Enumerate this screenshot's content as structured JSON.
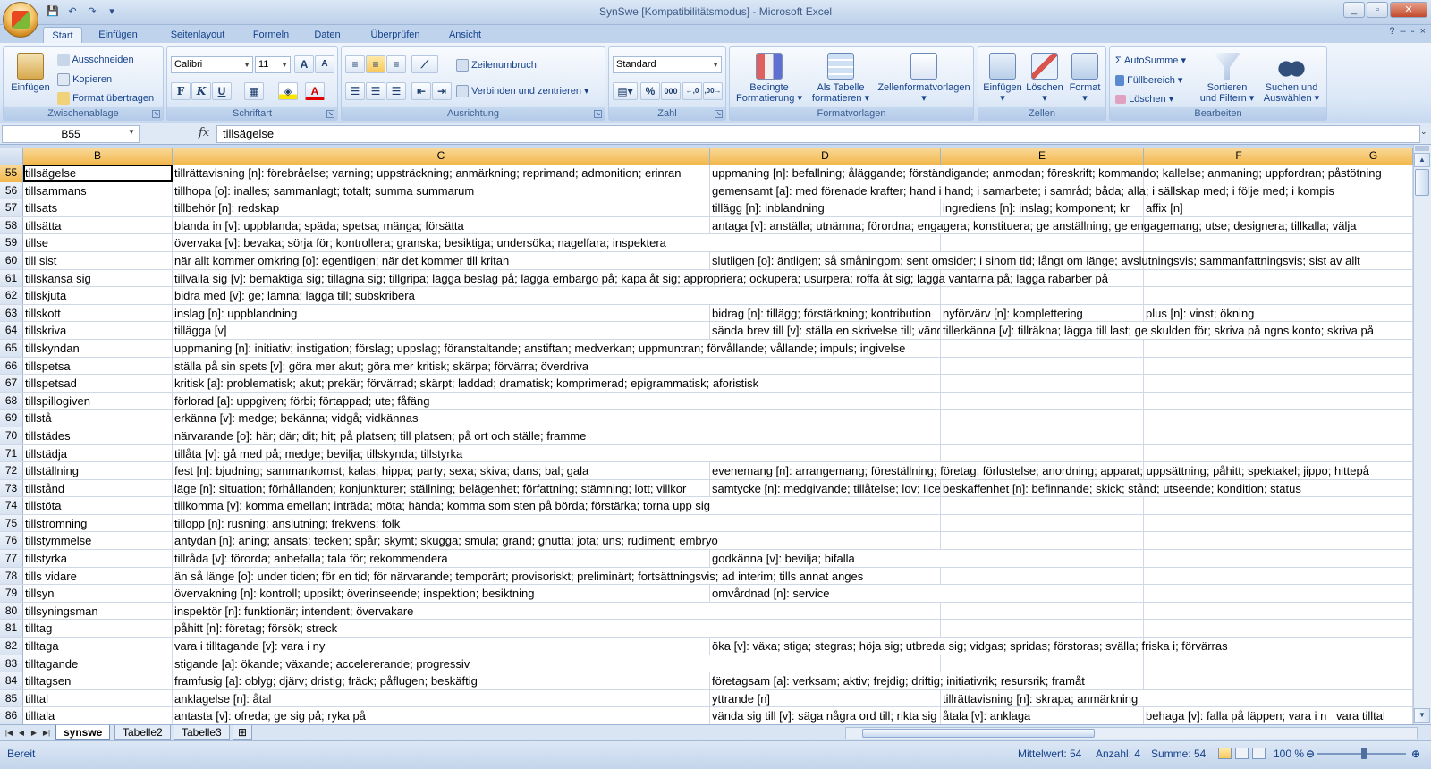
{
  "window": {
    "title": "SynSwe  [Kompatibilitätsmodus] - Microsoft Excel",
    "controls": [
      "_",
      "▫",
      "✕"
    ]
  },
  "quick_access": {
    "save": "💾",
    "undo": "↶",
    "redo": "↷",
    "more": "▾"
  },
  "tabs": [
    "Start",
    "Einfügen",
    "Seitenlayout",
    "Formeln",
    "Daten",
    "Überprüfen",
    "Ansicht"
  ],
  "ribbon": {
    "clipboard": {
      "label": "Zwischenablage",
      "paste": "Einfügen",
      "cut": "Ausschneiden",
      "copy": "Kopieren",
      "format_painter": "Format übertragen"
    },
    "font": {
      "label": "Schriftart",
      "font_name": "Calibri",
      "font_size": "11",
      "bold": "F",
      "italic": "K",
      "underline": "U",
      "grow": "A",
      "shrink": "A"
    },
    "alignment": {
      "label": "Ausrichtung",
      "wrap": "Zeilenumbruch",
      "merge": "Verbinden und zentrieren"
    },
    "number": {
      "label": "Zahl",
      "format": "Standard",
      "percent": "%",
      "thousands": "000"
    },
    "styles": {
      "label": "Formatvorlagen",
      "conditional": "Bedingte Formatierung",
      "as_table": "Als Tabelle formatieren",
      "cell_styles": "Zellenformatvorlagen"
    },
    "cells": {
      "label": "Zellen",
      "insert": "Einfügen",
      "delete": "Löschen",
      "format": "Format"
    },
    "editing": {
      "label": "Bearbeiten",
      "autosum": "AutoSumme",
      "fill": "Füllbereich",
      "clear": "Löschen",
      "sort": "Sortieren und Filtern",
      "find": "Suchen und Auswählen"
    }
  },
  "formula_bar": {
    "name_box": "B55",
    "fx": "fx",
    "content": "tillsägelse"
  },
  "columns": [
    "B",
    "C",
    "D",
    "E",
    "F",
    "G"
  ],
  "rows": [
    {
      "n": "55",
      "B": "tillsägelse",
      "C": "tillrättavisning [n]: förebråelse; varning; uppsträckning; anmärkning; reprimand; admonition; erinran",
      "D": "uppmaning [n]: befallning; åläggande; förständigande; anmodan; föreskrift; kommando; kallelse; anmaning; uppfordran; påstötning",
      "E": "",
      "F": "",
      "G": ""
    },
    {
      "n": "56",
      "B": "tillsammans",
      "C": "tillhopa [o]: inalles; sammanlagt; totalt; summa summarum",
      "D": "gemensamt [a]: med förenade krafter; hand i hand; i samarbete; i samråd; båda; alla; i sällskap med; i följe med; i kompis",
      "E": "",
      "F": "",
      "G": ""
    },
    {
      "n": "57",
      "B": "tillsats",
      "C": "tillbehör [n]: redskap",
      "D": "tillägg [n]: inblandning",
      "E": "ingrediens [n]: inslag; komponent; kr",
      "F": "affix [n]",
      "G": ""
    },
    {
      "n": "58",
      "B": "tillsätta",
      "C": "blanda in [v]: uppblanda; späda; spetsa; mänga; försätta",
      "D": "antaga [v]: anställa; utnämna; förordna; engagera; konstituera; ge anställning; ge engagemang; utse; designera; tillkalla; välja",
      "E": "",
      "F": "",
      "G": ""
    },
    {
      "n": "59",
      "B": "tillse",
      "C": "övervaka [v]: bevaka; sörja för; kontrollera; granska; besiktiga; undersöka; nagelfara; inspektera",
      "D": "",
      "E": "",
      "F": "",
      "G": ""
    },
    {
      "n": "60",
      "B": "till sist",
      "C": "när allt kommer omkring [o]: egentligen; när det kommer till kritan",
      "D": "slutligen [o]: äntligen; så småningom; sent omsider; i sinom tid; långt om länge; avslutningsvis; sammanfattningsvis; sist av allt",
      "E": "",
      "F": "",
      "G": ""
    },
    {
      "n": "61",
      "B": "tillskansa sig",
      "C": "tillvälla sig [v]: bemäktiga sig; tillägna sig; tillgripa; lägga beslag på; lägga embargo på; kapa åt sig; appropriera; ockupera; usurpera; roffa åt sig; lägga vantarna på; lägga rabarber på",
      "D": "",
      "E": "",
      "F": "",
      "G": ""
    },
    {
      "n": "62",
      "B": "tillskjuta",
      "C": "bidra med [v]: ge; lämna; lägga till; subskribera",
      "D": "",
      "E": "",
      "F": "",
      "G": ""
    },
    {
      "n": "63",
      "B": "tillskott",
      "C": "inslag [n]: uppblandning",
      "D": "bidrag [n]: tillägg; förstärkning; kontribution",
      "E": "nyförvärv [n]: komplettering",
      "F": "plus [n]: vinst; ökning",
      "G": ""
    },
    {
      "n": "64",
      "B": "tillskriva",
      "C": "tillägga [v]",
      "D": "sända brev till [v]: ställa en skrivelse till; vända sig till",
      "E": "tillerkänna [v]: tillräkna; lägga till last; ge skulden för; skriva på ngns konto; skriva på",
      "F": "",
      "G": ""
    },
    {
      "n": "65",
      "B": "tillskyndan",
      "C": "uppmaning [n]: initiativ; instigation; förslag; uppslag; föranstaltande; anstiftan; medverkan; uppmuntran; förvållande; vållande; impuls; ingivelse",
      "D": "",
      "E": "",
      "F": "",
      "G": ""
    },
    {
      "n": "66",
      "B": "tillspetsa",
      "C": "ställa på sin spets [v]: göra mer akut; göra mer kritisk; skärpa; förvärra; överdriva",
      "D": "",
      "E": "",
      "F": "",
      "G": ""
    },
    {
      "n": "67",
      "B": "tillspetsad",
      "C": "kritisk [a]: problematisk; akut; prekär; förvärrad; skärpt; laddad; dramatisk; komprimerad; epigrammatisk; aforistisk",
      "D": "",
      "E": "",
      "F": "",
      "G": ""
    },
    {
      "n": "68",
      "B": "tillspillogiven",
      "C": "förlorad [a]: uppgiven; förbi; förtappad; ute; fåfäng",
      "D": "",
      "E": "",
      "F": "",
      "G": ""
    },
    {
      "n": "69",
      "B": "tillstå",
      "C": "erkänna [v]: medge; bekänna; vidgå; vidkännas",
      "D": "",
      "E": "",
      "F": "",
      "G": ""
    },
    {
      "n": "70",
      "B": "tillstädes",
      "C": "närvarande [o]: här; där; dit; hit; på platsen; till platsen; på ort och ställe; framme",
      "D": "",
      "E": "",
      "F": "",
      "G": ""
    },
    {
      "n": "71",
      "B": "tillstädja",
      "C": "tillåta [v]: gå med på; medge; bevilja; tillskynda; tillstyrka",
      "D": "",
      "E": "",
      "F": "",
      "G": ""
    },
    {
      "n": "72",
      "B": "tillställning",
      "C": "fest [n]: bjudning; sammankomst; kalas; hippa; party; sexa; skiva; dans; bal; gala",
      "D": "evenemang [n]: arrangemang; föreställning; företag; förlustelse; anordning; apparat; uppsättning; påhitt; spektakel; jippo; hittepå",
      "E": "",
      "F": "",
      "G": ""
    },
    {
      "n": "73",
      "B": "tillstånd",
      "C": "läge [n]: situation; förhållanden; konjunkturer; ställning; belägenhet; författning; stämning; lott; villkor",
      "D": "samtycke [n]: medgivande; tillåtelse; lov; licens",
      "E": "beskaffenhet [n]: befinnande; skick; stånd; utseende; kondition; status",
      "F": "",
      "G": ""
    },
    {
      "n": "74",
      "B": "tillstöta",
      "C": "tillkomma [v]: komma emellan; inträda; möta; hända; komma som sten på börda; förstärka; torna upp sig",
      "D": "",
      "E": "",
      "F": "",
      "G": ""
    },
    {
      "n": "75",
      "B": "tillströmning",
      "C": "tillopp [n]: rusning; anslutning; frekvens; folk",
      "D": "",
      "E": "",
      "F": "",
      "G": ""
    },
    {
      "n": "76",
      "B": "tillstymmelse",
      "C": "antydan [n]: aning; ansats; tecken; spår; skymt; skugga; smula; grand; gnutta; jota; uns; rudiment; embryo",
      "D": "",
      "E": "",
      "F": "",
      "G": ""
    },
    {
      "n": "77",
      "B": "tillstyrka",
      "C": "tillråda [v]: förorda; anbefalla; tala för; rekommendera",
      "D": "godkänna [v]: bevilja; bifalla",
      "E": "",
      "F": "",
      "G": ""
    },
    {
      "n": "78",
      "B": "tills vidare",
      "C": "än så länge [o]: under tiden; för en tid; för närvarande; temporärt; provisoriskt; preliminärt; fortsättningsvis; ad interim; tills annat anges",
      "D": "",
      "E": "",
      "F": "",
      "G": ""
    },
    {
      "n": "79",
      "B": "tillsyn",
      "C": "övervakning [n]: kontroll; uppsikt; överinseende; inspektion; besiktning",
      "D": "omvårdnad [n]: service",
      "E": "",
      "F": "",
      "G": ""
    },
    {
      "n": "80",
      "B": "tillsyningsman",
      "C": "inspektör [n]: funktionär; intendent; övervakare",
      "D": "",
      "E": "",
      "F": "",
      "G": ""
    },
    {
      "n": "81",
      "B": "tilltag",
      "C": "påhitt [n]: företag; försök; streck",
      "D": "",
      "E": "",
      "F": "",
      "G": ""
    },
    {
      "n": "82",
      "B": "tilltaga",
      "C": "vara i tilltagande [v]: vara i ny",
      "D": "öka [v]: växa; stiga; stegras; höja sig; utbreda sig; vidgas; spridas; förstoras; svälla; friska i; förvärras",
      "E": "",
      "F": "",
      "G": ""
    },
    {
      "n": "83",
      "B": "tilltagande",
      "C": "stigande [a]: ökande; växande; accelererande; progressiv",
      "D": "",
      "E": "",
      "F": "",
      "G": ""
    },
    {
      "n": "84",
      "B": "tilltagsen",
      "C": "framfusig [a]: oblyg; djärv; dristig; fräck; påflugen; beskäftig",
      "D": "företagsam [a]: verksam; aktiv; frejdig; driftig; initiativrik; resursrik; framåt",
      "E": "",
      "F": "",
      "G": ""
    },
    {
      "n": "85",
      "B": "tilltal",
      "C": "anklagelse [n]: åtal",
      "D": "yttrande [n]",
      "E": "tillrättavisning [n]: skrapa; anmärkning",
      "F": "",
      "G": ""
    },
    {
      "n": "86",
      "B": "tilltala",
      "C": "antasta [v]: ofreda; ge sig på; ryka på",
      "D": "vända sig till [v]: säga några ord till; rikta sig",
      "E": "åtala [v]: anklaga",
      "F": "behaga [v]: falla på läppen; vara i n",
      "G": "vara tilltal"
    }
  ],
  "sheets": [
    "synswe",
    "Tabelle2",
    "Tabelle3"
  ],
  "status": {
    "ready": "Bereit",
    "average": "Mittelwert: 54",
    "count": "Anzahl: 4",
    "sum": "Summe: 54",
    "zoom": "100 %"
  }
}
